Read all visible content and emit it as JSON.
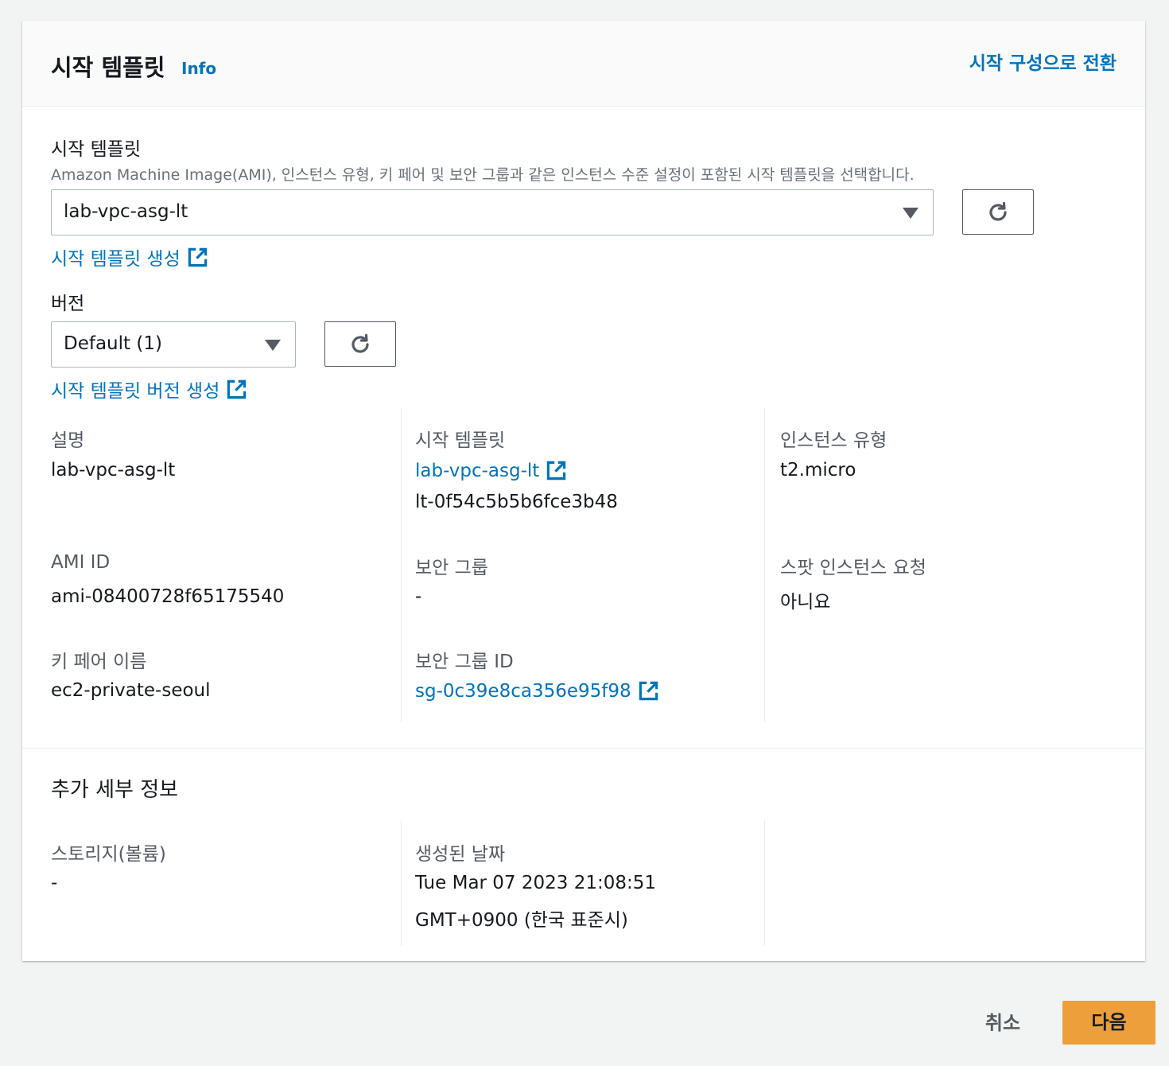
{
  "header": {
    "title": "시작 템플릿",
    "info_label": "Info",
    "switch_label": "시작 구성으로 전환"
  },
  "launch_template": {
    "label": "시작 템플릿",
    "description": "Amazon Machine Image(AMI), 인스턴스 유형, 키 페어 및 보안 그룹과 같은 인스턴스 수준 설정이 포함된 시작 템플릿을 선택합니다.",
    "selected": "lab-vpc-asg-lt",
    "create_link": "시작 템플릿 생성"
  },
  "version": {
    "label": "버전",
    "selected": "Default (1)",
    "create_link": "시작 템플릿 버전 생성"
  },
  "details": {
    "description_key": "설명",
    "description_val": "lab-vpc-asg-lt",
    "template_key": "시작 템플릿",
    "template_link": "lab-vpc-asg-lt",
    "template_id": "lt-0f54c5b5b6fce3b48",
    "instance_type_key": "인스턴스 유형",
    "instance_type_val": "t2.micro",
    "ami_key": "AMI ID",
    "ami_val": "ami-08400728f65175540",
    "sg_key": "보안 그룹",
    "sg_val": "-",
    "spot_key": "스팟 인스턴스 요청",
    "spot_val": "아니요",
    "keypair_key": "키 페어 이름",
    "keypair_val": "ec2-private-seoul",
    "sgid_key": "보안 그룹 ID",
    "sgid_link": "sg-0c39e8ca356e95f98"
  },
  "additional": {
    "title": "추가 세부 정보",
    "storage_key": "스토리지(볼륨)",
    "storage_val": "-",
    "created_key": "생성된 날짜",
    "created_line1": "Tue Mar 07 2023 21:08:51",
    "created_line2": "GMT+0900 (한국 표준시)"
  },
  "footer": {
    "cancel_label": "취소",
    "next_label": "다음"
  },
  "colors": {
    "link": "#0073bb",
    "primary_button": "#ec9f3b",
    "background": "#f2f3f3"
  },
  "icons": [
    "refresh-icon",
    "external-link-icon",
    "caret-down-icon"
  ]
}
